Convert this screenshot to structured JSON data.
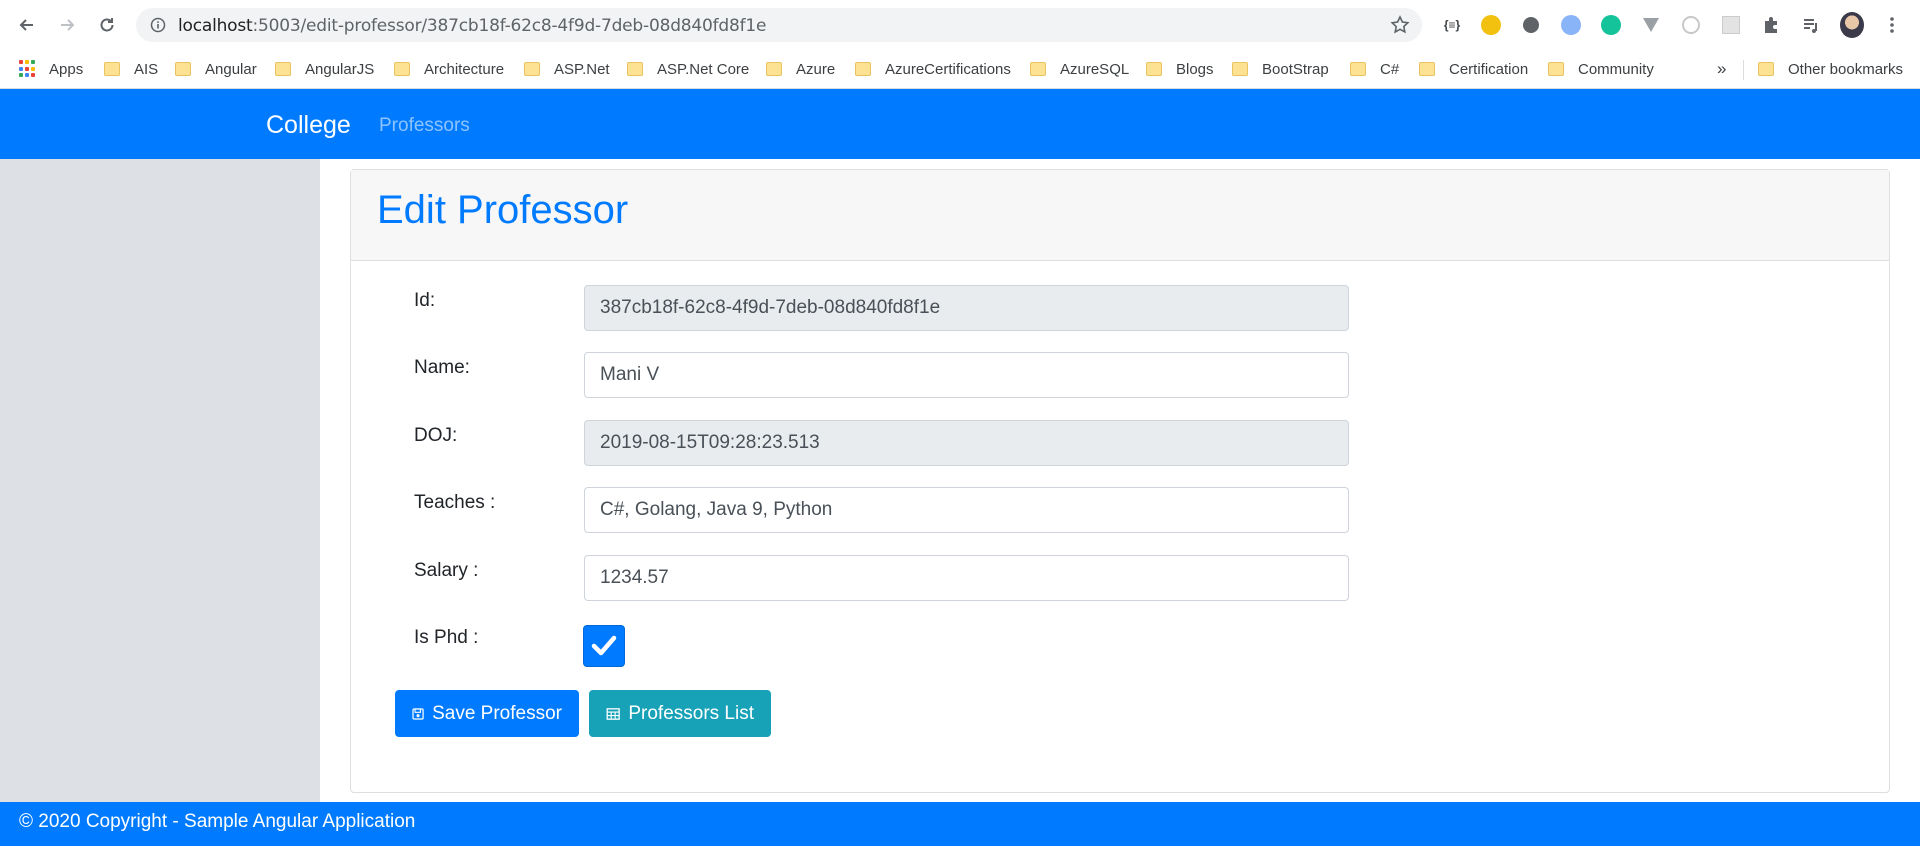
{
  "browser": {
    "url_host": "localhost",
    "url_path": ":5003/edit-professor/387cb18f-62c8-4f9d-7deb-08d840fd8f1e",
    "extensions": [
      "json-viewer-icon",
      "moon-icon",
      "circle-icon",
      "pen-icon",
      "grammarly-icon",
      "vue-icon",
      "target-icon",
      "grid-icon",
      "puzzle-icon",
      "playlist-icon",
      "profile-avatar",
      "more-menu-icon"
    ],
    "more_bookmarks": "»",
    "other_bookmarks": "Other bookmarks",
    "bookmarks": [
      "Apps",
      "AIS",
      "Angular",
      "AngularJS",
      "Architecture",
      "ASP.Net",
      "ASP.Net Core",
      "Azure",
      "AzureCertifications",
      "AzureSQL",
      "Blogs",
      "BootStrap",
      "C#",
      "Certification",
      "Community"
    ]
  },
  "navbar": {
    "brand": "College",
    "link": "Professors"
  },
  "page": {
    "title": "Edit Professor"
  },
  "form": {
    "id_label": "Id:",
    "id_value": "387cb18f-62c8-4f9d-7deb-08d840fd8f1e",
    "name_label": "Name:",
    "name_value": "Mani V",
    "doj_label": "DOJ:",
    "doj_value": "2019-08-15T09:28:23.513",
    "teaches_label": "Teaches :",
    "teaches_value": "C#, Golang, Java 9, Python",
    "salary_label": "Salary :",
    "salary_value": "1234.57",
    "isphd_label": "Is Phd :",
    "isphd_checked": true
  },
  "buttons": {
    "save": "Save Professor",
    "list": "Professors List"
  },
  "footer": {
    "text": "© 2020 Copyright - Sample Angular Application"
  },
  "colors": {
    "primary": "#007bff",
    "info": "#17a2b8",
    "sidebar": "#dde1e6"
  }
}
